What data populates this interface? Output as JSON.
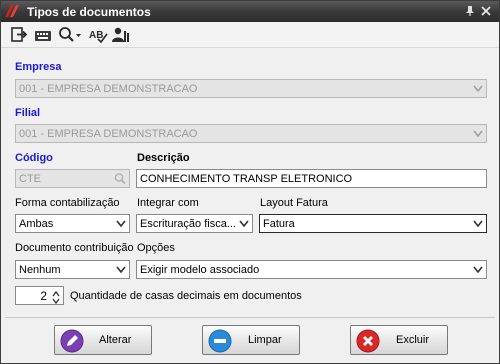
{
  "window": {
    "title": "Tipos de documentos",
    "icons": {
      "app": "app-logo-icon",
      "pin": "pin-icon",
      "close": "close-icon"
    }
  },
  "toolbar": {
    "icons": [
      "exit-icon",
      "keyboard-icon",
      "search-icon",
      "spellcheck-icon",
      "users-icon"
    ]
  },
  "form": {
    "empresa": {
      "label": "Empresa",
      "value": "001 - EMPRESA DEMONSTRACAO"
    },
    "filial": {
      "label": "Filial",
      "value": "001 - EMPRESA DEMONSTRACAO"
    },
    "codigo": {
      "label": "Código",
      "value": "CTE"
    },
    "descricao": {
      "label": "Descrição",
      "value": "CONHECIMENTO TRANSP ELETRONICO"
    },
    "forma_contabilizacao": {
      "label": "Forma contabilização",
      "value": "Ambas"
    },
    "integrar_com": {
      "label": "Integrar com",
      "value": "Escrituração fisca..."
    },
    "layout_fatura": {
      "label": "Layout Fatura",
      "value": "Fatura"
    },
    "documento_contribuicao": {
      "label": "Documento contribuição",
      "value": "Nenhum"
    },
    "opcoes": {
      "label": "Opções",
      "value": "Exigir modelo associado"
    },
    "casas_decimais": {
      "value": "2",
      "label": "Quantidade de casas decimais em documentos"
    }
  },
  "buttons": {
    "alterar": {
      "label": "Alterar"
    },
    "limpar": {
      "label": "Limpar"
    },
    "excluir": {
      "label": "Excluir"
    }
  }
}
